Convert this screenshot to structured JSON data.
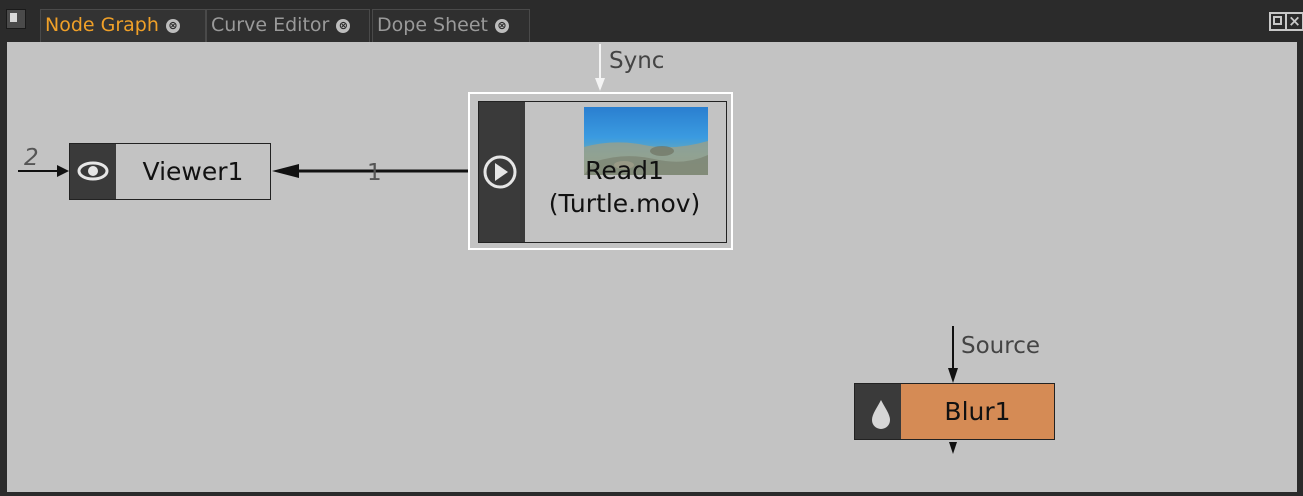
{
  "tabs": [
    {
      "label": "Node Graph",
      "active": true
    },
    {
      "label": "Curve Editor",
      "active": false
    },
    {
      "label": "Dope Sheet",
      "active": false
    }
  ],
  "tab_close_glyph": "⊗",
  "window_buttons": {
    "maximize_icon": "maximize-icon",
    "close_glyph": "×"
  },
  "graph": {
    "edge_labels": {
      "viewer_input_2": "2",
      "read_to_viewer": "1",
      "read_input": "Sync",
      "blur_input": "Source"
    },
    "nodes": {
      "viewer": {
        "label": "Viewer1",
        "icon": "eye-icon",
        "color": "#c3c3c3"
      },
      "read": {
        "label_line1": "Read1",
        "label_line2": "(Turtle.mov)",
        "icon": "play-icon",
        "color": "#c3c3c3",
        "thumbnail": "underwater-thumbnail"
      },
      "blur": {
        "label": "Blur1",
        "icon": "droplet-icon",
        "color": "#d58b55"
      }
    }
  }
}
